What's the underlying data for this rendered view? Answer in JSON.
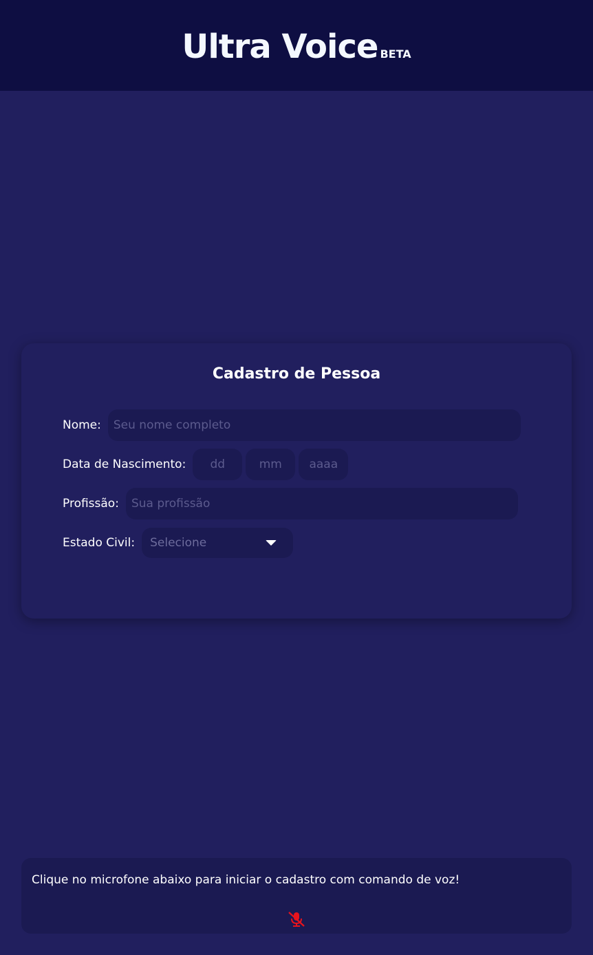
{
  "header": {
    "title": "Ultra Voice",
    "badge": "BETA"
  },
  "form": {
    "title": "Cadastro de Pessoa",
    "nome": {
      "label": "Nome:",
      "placeholder": "Seu nome completo",
      "value": ""
    },
    "nascimento": {
      "label": "Data de Nascimento:",
      "day_placeholder": "dd",
      "month_placeholder": "mm",
      "year_placeholder": "aaaa"
    },
    "profissao": {
      "label": "Profissão:",
      "placeholder": "Sua profissão",
      "value": ""
    },
    "estado_civil": {
      "label": "Estado Civil:",
      "selected": "Selecione"
    }
  },
  "voice": {
    "instruction": "Clique no microfone abaixo para iniciar o cadastro com comando de voz!",
    "mic_icon": "microphone-off-icon",
    "mic_color": "#e8131c"
  },
  "colors": {
    "background": "#211f5e",
    "header": "#0e0e42",
    "field": "#1b1a52"
  }
}
